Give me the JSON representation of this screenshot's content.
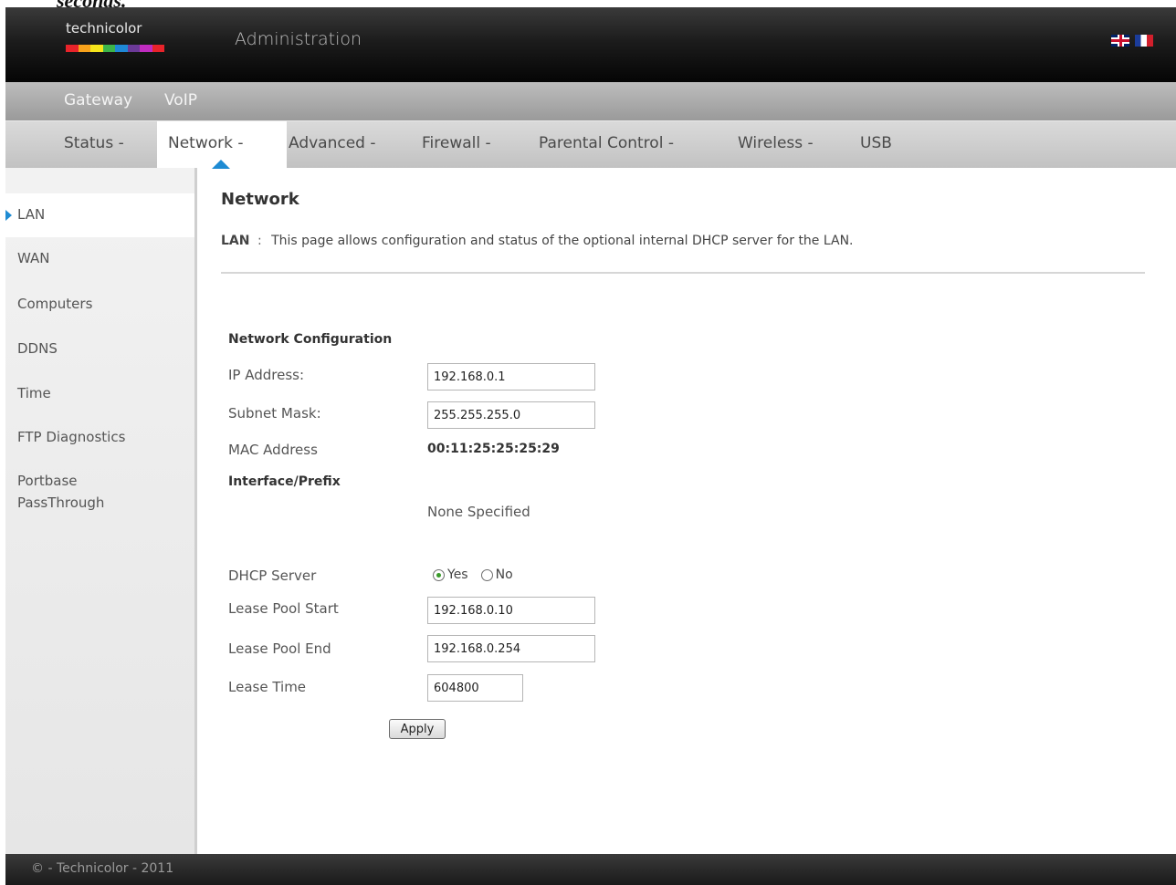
{
  "doc_fragment": "seconds.",
  "header": {
    "logo_text": "technicolor",
    "title": "Administration",
    "flags": [
      "uk-flag-icon",
      "france-flag-icon"
    ],
    "logo_colors": [
      "#e8232a",
      "#f7a21b",
      "#f6e51b",
      "#3cb54a",
      "#1e88d6",
      "#6c3a98",
      "#c02cc0",
      "#e8232a"
    ]
  },
  "nav_primary": [
    "Gateway",
    "VoIP"
  ],
  "nav_secondary": {
    "items": [
      "Status -",
      "Network -",
      "Advanced -",
      "Firewall -",
      "Parental Control -",
      "Wireless -",
      "USB"
    ],
    "active": "Network -"
  },
  "sidebar": {
    "items": [
      "LAN",
      "WAN",
      "Computers",
      "DDNS",
      "Time",
      "FTP Diagnostics",
      "Portbase",
      "PassThrough"
    ],
    "active": "LAN"
  },
  "main": {
    "title": "Network",
    "desc_label": "LAN",
    "desc_sep": ":",
    "desc_text": "This page allows configuration and status of the optional internal DHCP server for the LAN.",
    "section_title": "Network Configuration",
    "ip_label": "IP Address:",
    "ip_value": "192.168.0.1",
    "subnet_label": "Subnet Mask:",
    "subnet_value": "255.255.255.0",
    "mac_label": "MAC Address",
    "mac_value": "00:11:25:25:25:29",
    "prefix_label": "Interface/Prefix",
    "prefix_value": "None Specified",
    "dhcp_label": "DHCP Server",
    "dhcp_yes": "Yes",
    "dhcp_no": "No",
    "dhcp_selected": "Yes",
    "pool_start_label": "Lease Pool Start",
    "pool_start_value": "192.168.0.10",
    "pool_end_label": "Lease Pool End",
    "pool_end_value": "192.168.0.254",
    "lease_time_label": "Lease Time",
    "lease_time_value": "604800",
    "apply_label": "Apply"
  },
  "footer": {
    "text": "© - Technicolor - 2011"
  },
  "colors": {
    "accent": "#1e8bd3",
    "radio_selected": "#3a9b2a"
  }
}
